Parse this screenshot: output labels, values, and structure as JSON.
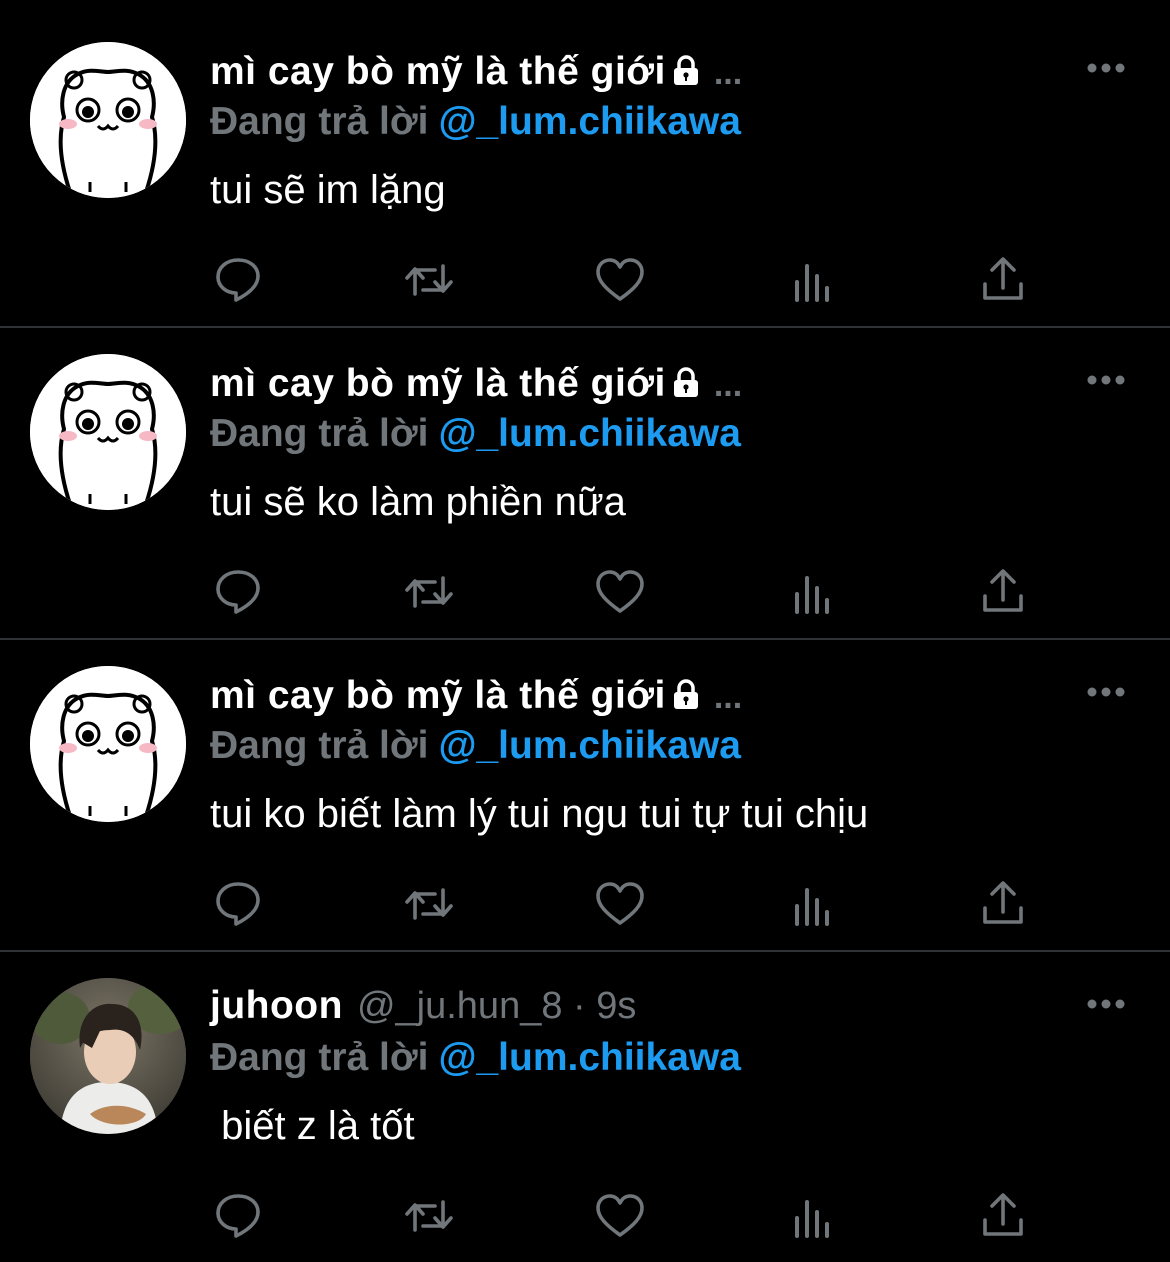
{
  "tweets": [
    {
      "name": "mì cay bò mỹ là thế giới",
      "locked": true,
      "overflow": "...",
      "reply_prefix": "Đang trả lời",
      "reply_to": "@_lum.chiikawa",
      "text": "tui sẽ im lặng",
      "avatar": "chiikawa-character"
    },
    {
      "name": "mì cay bò mỹ là thế giới",
      "locked": true,
      "overflow": "...",
      "reply_prefix": "Đang trả lời",
      "reply_to": "@_lum.chiikawa",
      "text": "tui sẽ ko làm phiền nữa",
      "avatar": "chiikawa-character"
    },
    {
      "name": "mì cay bò mỹ là thế giới",
      "locked": true,
      "overflow": "...",
      "reply_prefix": "Đang trả lời",
      "reply_to": "@_lum.chiikawa",
      "text": "tui ko biết làm lý tui ngu tui tự tui chịu",
      "avatar": "chiikawa-character"
    },
    {
      "name": "juhoon",
      "handle": "@_ju.hun_8 · 9s",
      "reply_prefix": "Đang trả lời",
      "reply_to": "@_lum.chiikawa",
      "text": " biết z là tốt",
      "avatar": "person-photo"
    }
  ],
  "icons": [
    "reply-icon",
    "retweet-icon",
    "like-icon",
    "views-icon",
    "share-icon",
    "more-icon",
    "lock-icon"
  ],
  "colors": {
    "background": "#000000",
    "text": "#ffffff",
    "muted": "#71767b",
    "link": "#1d9bf0",
    "divider": "#2f3336"
  }
}
